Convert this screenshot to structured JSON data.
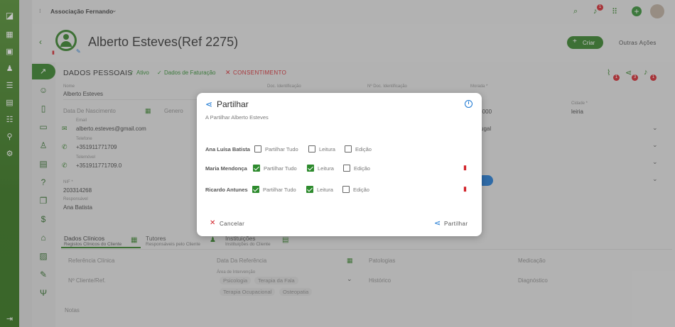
{
  "topbar": {
    "org": "Associação Fernando",
    "notification_count": "1"
  },
  "header": {
    "title": "Alberto Esteves(Ref 2275)",
    "create_label": "Criar",
    "other_actions_label": "Outras Ações"
  },
  "personal": {
    "section_title": "DADOS PESSOAIS",
    "tag_active": "Ativo",
    "tag_billing": "Dados de Faturação",
    "tag_consent": "CONSENTIMENTO"
  },
  "status_badges": {
    "attachments": "1",
    "shares": "3",
    "notifications": "1"
  },
  "fields": {
    "name_label": "Nome",
    "name_value": "Alberto Esteves",
    "birth_label": "Data De Nascimento",
    "gender_label": "Genero",
    "email_label": "Email",
    "email_value": "alberto.esteves@gmail.com",
    "phone_label": "Telefone",
    "phone_value": "+351911771709",
    "phone2_label": "Telemóvel",
    "phone2_value": "+351911771709.0",
    "nif_label": "NIF *",
    "nif_value": "203314268",
    "responsible_label": "Responsável",
    "responsible_value": "Ana Batista",
    "docid_label": "Doc. Identificação",
    "ndoc_label": "Nº Doc. Identificação",
    "address_label": "Morada *",
    "city_label": "Cidade *",
    "city_value": "leiria",
    "postal_value": "-000",
    "country_value": "ugal"
  },
  "tabs": [
    {
      "title": "Dados Clínicos",
      "subtitle": "Registos Clínicos do Cliente"
    },
    {
      "title": "Tutores",
      "subtitle": "Responsáveis pelo Cliente"
    },
    {
      "title": "Instituições",
      "subtitle": "Instituições do Cliente"
    }
  ],
  "clinical": {
    "ref_label": "Referência Clínica",
    "date_label": "Data Da Referência",
    "pathologies_label": "Patologias",
    "medication_label": "Medicação",
    "client_no_label": "Nº Cliente/Ref.",
    "areas_label": "Área de Intervenção",
    "history_label": "Histórico",
    "diagnosis_label": "Diagnóstico",
    "notes_label": "Notas",
    "areas": [
      "Psicologia",
      "Terapia da Fala",
      "Terapia Ocupacional",
      "Osteopatia"
    ]
  },
  "modal": {
    "title": "Partilhar",
    "subtitle": "A Partilhar Alberto Esteves",
    "col_share_all": "Partilhar Tudo",
    "col_read": "Leitura",
    "col_edit": "Edição",
    "rows": [
      {
        "name": "Ana Luísa Batista",
        "share_all": false,
        "read": false,
        "edit": false
      },
      {
        "name": "Maria Mendonça",
        "share_all": true,
        "read": true,
        "edit": false
      },
      {
        "name": "Ricardo Antunes",
        "share_all": true,
        "read": true,
        "edit": false
      }
    ],
    "cancel_label": "Cancelar",
    "share_label": "Partilhar"
  },
  "colors": {
    "brand_green": "#2e8b2e",
    "danger_red": "#d2232a",
    "info_blue": "#1976d2"
  }
}
